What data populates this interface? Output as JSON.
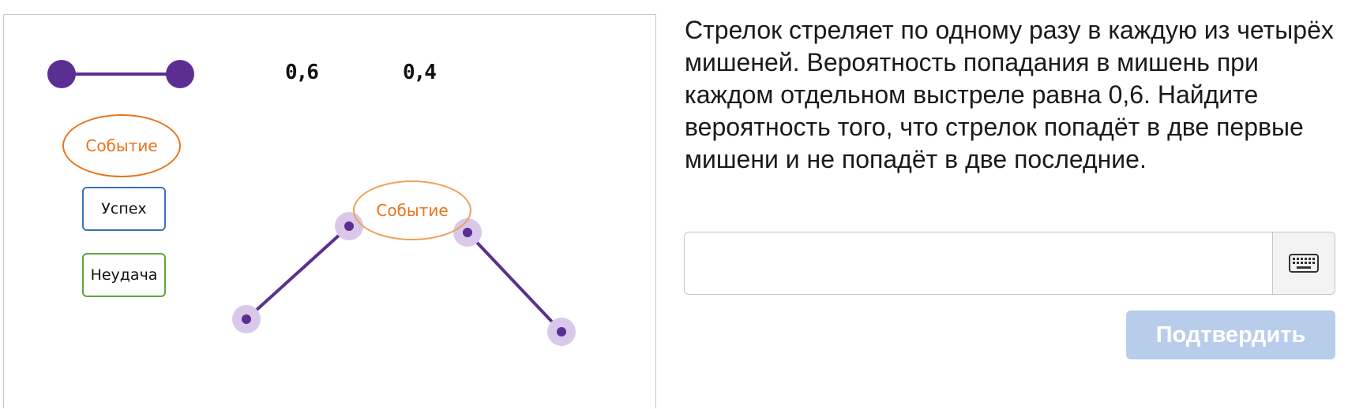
{
  "task": {
    "text": "Стрелок стреляет по одному разу в каждую из четырёх мишеней. Вероятность попадания в мишень при каждом отдельном выстреле равна 0,6. Найдите вероятность того, что стрелок попадёт в две первые мишени и не попадёт в две последние."
  },
  "palette": {
    "prob_hit": "0,6",
    "prob_miss": "0,4",
    "event_label": "Событие",
    "success_label": "Успех",
    "failure_label": "Неудача"
  },
  "tree": {
    "event_label": "Событие"
  },
  "answer": {
    "value": "",
    "placeholder": "",
    "keyboard_icon": "keyboard-icon"
  },
  "confirm_label": "Подтвердить",
  "colors": {
    "edge": "#5b2f91",
    "node_halo": "#d9c8ea",
    "event": "#e8731a",
    "success_border": "#3a6fbf",
    "failure_border": "#5ea83c",
    "confirm_bg": "#b8cdea"
  }
}
